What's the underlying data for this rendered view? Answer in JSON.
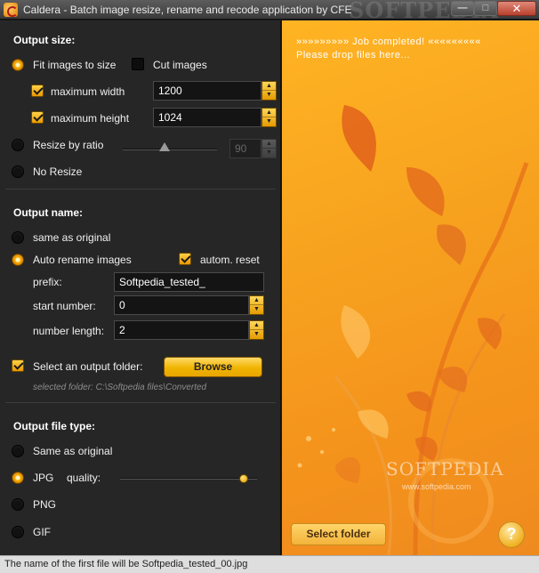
{
  "window": {
    "title": "Caldera - Batch image resize, rename and recode application by CFE",
    "watermark": "SOFTPEDIA",
    "controls": {
      "minimize": "—",
      "maximize": "□",
      "close": "✕"
    }
  },
  "output_size": {
    "title": "Output size:",
    "fit_label": "Fit images to size",
    "fit_selected": true,
    "cut_label": "Cut images",
    "cut_checked": false,
    "max_width_label": "maximum width",
    "max_width_checked": true,
    "max_width_value": "1200",
    "max_height_label": "maximum height",
    "max_height_checked": true,
    "max_height_value": "1024",
    "ratio_label": "Resize by ratio",
    "ratio_value": "90",
    "no_resize_label": "No Resize"
  },
  "output_name": {
    "title": "Output name:",
    "same_label": "same as original",
    "auto_label": "Auto rename images",
    "auto_reset_label": "autom. reset",
    "auto_reset_checked": true,
    "prefix_label": "prefix:",
    "prefix_value": "Softpedia_tested_",
    "start_label": "start number:",
    "start_value": "0",
    "length_label": "number length:",
    "length_value": "2",
    "select_folder_label": "Select an output folder:",
    "select_folder_checked": true,
    "browse_label": "Browse",
    "selected_folder_text": "selected folder: C:\\Softpedia files\\Converted"
  },
  "output_type": {
    "title": "Output file type:",
    "same_label": "Same as original",
    "jpg_label": "JPG",
    "quality_label": "quality:",
    "quality_fraction": 0.94,
    "png_label": "PNG",
    "gif_label": "GIF",
    "selected": "JPG"
  },
  "right_panel": {
    "job_text": "»»»»»»»»»  Job completed!  «««««««««",
    "drop_text": "Please drop files here...",
    "select_folder_label": "Select folder",
    "help_label": "?",
    "watermark": "SOFTPEDIA",
    "watermark_url": "www.softpedia.com"
  },
  "status": {
    "text": "The name of the first file will be Softpedia_tested_00.jpg"
  },
  "colors": {
    "accent": "#f0b400",
    "panel": "#262626",
    "right_bg": "#f7a21f"
  }
}
